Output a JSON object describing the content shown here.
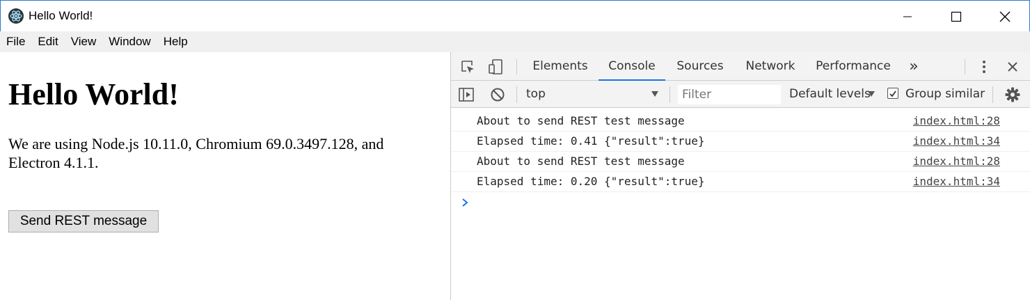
{
  "window": {
    "title": "Hello World!",
    "controls": [
      "minimize",
      "maximize",
      "close"
    ]
  },
  "menu": [
    "File",
    "Edit",
    "View",
    "Window",
    "Help"
  ],
  "page": {
    "heading": "Hello World!",
    "text": "We are using Node.js 10.11.0, Chromium 69.0.3497.128, and Electron 4.1.1.",
    "button_label": "Send REST message"
  },
  "devtools": {
    "tabs": [
      {
        "label": "Elements",
        "active": false
      },
      {
        "label": "Console",
        "active": true
      },
      {
        "label": "Sources",
        "active": false
      },
      {
        "label": "Network",
        "active": false
      },
      {
        "label": "Performance",
        "active": false
      }
    ],
    "more_tabs": "»",
    "context": "top",
    "filter_placeholder": "Filter",
    "levels": "Default levels",
    "group_similar": "Group similar",
    "group_similar_checked": true,
    "accent_color": "#1a73e8",
    "messages": [
      {
        "text": "About to send REST test message",
        "source": "index.html:28"
      },
      {
        "text": "Elapsed time: 0.41 {\"result\":true}",
        "source": "index.html:34"
      },
      {
        "text": "About to send REST test message",
        "source": "index.html:28"
      },
      {
        "text": "Elapsed time: 0.20 {\"result\":true}",
        "source": "index.html:34"
      }
    ]
  }
}
